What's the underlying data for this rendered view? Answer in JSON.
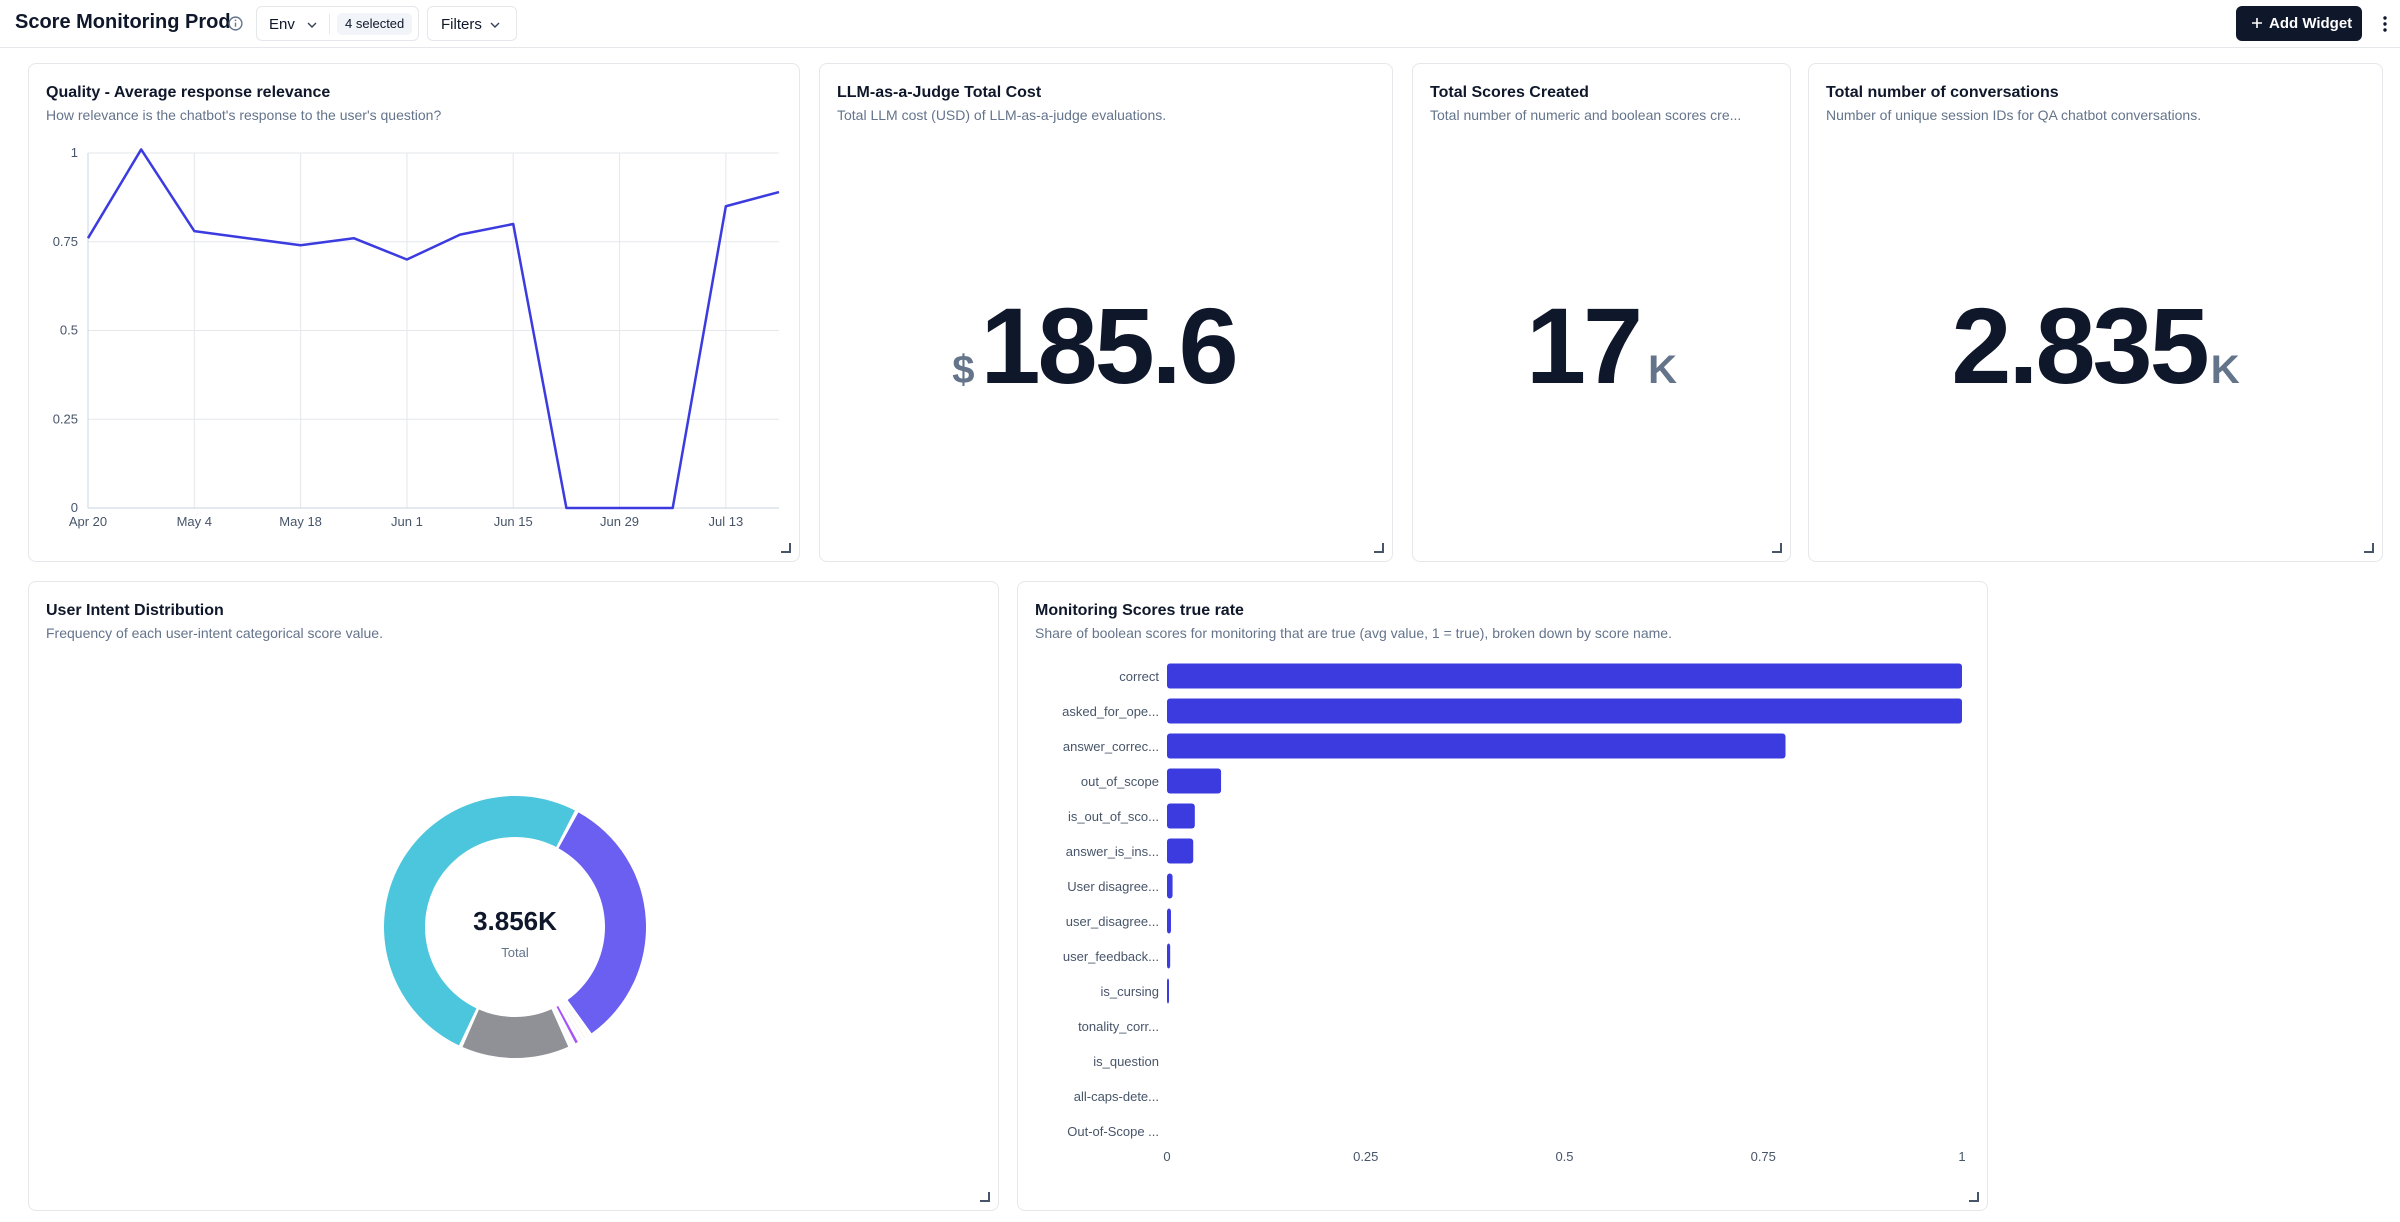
{
  "header": {
    "title": "Score Monitoring Prod",
    "env_label": "Env",
    "env_badge": "4 selected",
    "filters_label": "Filters",
    "add_widget_label": "Add Widget"
  },
  "widgets": {
    "relevance": {
      "title": "Quality - Average response relevance",
      "description": "How relevance is the chatbot's response to the user's question?"
    },
    "cost": {
      "title": "LLM-as-a-Judge Total Cost",
      "description": "Total LLM cost (USD) of LLM-as-a-judge evaluations.",
      "prefix": "$",
      "value": "185.6"
    },
    "scores": {
      "title": "Total Scores Created",
      "description": "Total number of numeric and boolean scores cre...",
      "value": "17",
      "suffix": "K"
    },
    "conversations": {
      "title": "Total number of conversations",
      "description": "Number of unique session IDs for QA chatbot conversations.",
      "value": "2.835",
      "suffix": "K"
    },
    "intent": {
      "title": "User Intent Distribution",
      "description": "Frequency of each user-intent categorical score value."
    },
    "monitoring": {
      "title": "Monitoring Scores true rate",
      "description": "Share of boolean scores for monitoring that are true (avg value, 1 = true), broken down by score name."
    }
  },
  "chart_data": [
    {
      "type": "line",
      "title": "Quality - Average response relevance",
      "x_ticks": [
        "Apr 20",
        "May 4",
        "May 18",
        "Jun 1",
        "Jun 15",
        "Jun 29",
        "Jul 13"
      ],
      "y_ticks": [
        "1",
        "0.75",
        "0.5",
        "0.25",
        "0"
      ],
      "ylim": [
        0,
        1
      ],
      "grid": true,
      "color": "#3b3be0",
      "x": [
        "Apr 20",
        "Apr 27",
        "May 4",
        "May 11",
        "May 18",
        "May 25",
        "Jun 1",
        "Jun 8",
        "Jun 15",
        "Jun 22",
        "Jun 29",
        "Jul 6",
        "Jul 13",
        "Jul 20"
      ],
      "values": [
        0.76,
        1.01,
        0.78,
        0.76,
        0.74,
        0.76,
        0.7,
        0.77,
        0.8,
        0.0,
        0.0,
        0.0,
        0.85,
        0.89
      ]
    },
    {
      "type": "pie",
      "title": "User Intent Distribution",
      "center_value": "3.856K",
      "center_label": "Total",
      "slices": [
        {
          "value": 0.325,
          "color": "#6a5ff0"
        },
        {
          "value": 0.005,
          "color": "#f7d7a6"
        },
        {
          "value": 0.005,
          "color": "#f0c987"
        },
        {
          "value": 0.005,
          "color": "#c9b3f5"
        },
        {
          "value": 0.008,
          "color": "#a855f7"
        },
        {
          "value": 0.005,
          "color": "#e5e7eb"
        },
        {
          "value": 0.137,
          "color": "#8f9197"
        },
        {
          "value": 0.51,
          "color": "#4cc6dd"
        }
      ]
    },
    {
      "type": "bar",
      "orientation": "horizontal",
      "title": "Monitoring Scores true rate",
      "categories": [
        "correct",
        "asked_for_ope...",
        "answer_correc...",
        "out_of_scope",
        "is_out_of_sco...",
        "answer_is_ins...",
        "User disagree...",
        "user_disagree...",
        "user_feedback...",
        "is_cursing",
        "tonality_corr...",
        "is_question",
        "all-caps-dete...",
        "Out-of-Scope ..."
      ],
      "values": [
        1.0,
        1.0,
        0.778,
        0.068,
        0.035,
        0.033,
        0.007,
        0.005,
        0.004,
        0.001,
        0,
        0,
        0,
        0
      ],
      "x_ticks": [
        "0",
        "0.25",
        "0.5",
        "0.75",
        "1"
      ],
      "xlim": [
        0,
        1
      ],
      "color": "#3b3be0"
    }
  ]
}
